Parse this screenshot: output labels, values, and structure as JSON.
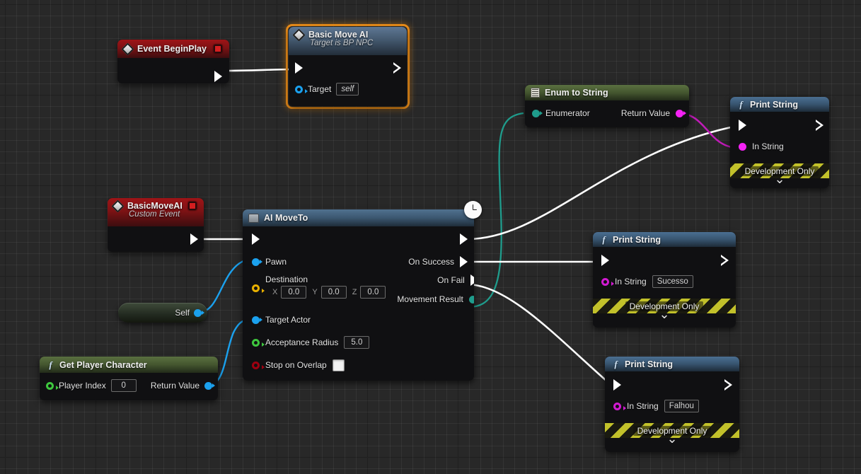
{
  "app": {
    "name": "Unreal Engine Blueprint Graph"
  },
  "canvas": {
    "grid_color": "#404040",
    "background_color": "#282828",
    "selection_color": "#f0901a"
  },
  "pin_colors": {
    "exec": "#ffffff",
    "object": "#1ba1ee",
    "vector": "#e8b000",
    "float": "#3ec73e",
    "boolean": "#9d0010",
    "string": "#f522f5",
    "enum": "#1f9c8c"
  },
  "nodes": {
    "event_begin_play": {
      "title": "Event BeginPlay",
      "icon": "event-diamond-icon",
      "delegate_icon": "red-square-icon"
    },
    "basic_move_ai": {
      "title": "Basic Move AI",
      "subtitle": "Target is BP NPC",
      "icon": "event-diamond-icon",
      "selected": true,
      "inputs": [
        {
          "label": "Target",
          "value": "self",
          "type": "object"
        }
      ]
    },
    "custom_event": {
      "title": "BasicMoveAI",
      "subtitle": "Custom Event",
      "icon": "event-diamond-icon",
      "delegate_icon": "red-square-icon"
    },
    "self_node": {
      "label": "Self",
      "type": "object"
    },
    "get_player_character": {
      "title": "Get Player Character",
      "icon": "function-f-icon",
      "inputs": [
        {
          "label": "Player Index",
          "value": "0",
          "type": "int"
        }
      ],
      "outputs": [
        {
          "label": "Return Value",
          "type": "object"
        }
      ]
    },
    "ai_move_to": {
      "title": "AI MoveTo",
      "icon": "gray-block-icon",
      "latent_icon": "clock-icon",
      "inputs": [
        {
          "label": "Pawn",
          "type": "object"
        },
        {
          "label": "Destination",
          "type": "vector",
          "vector": {
            "x_axis": "X",
            "x": "0.0",
            "y_axis": "Y",
            "y": "0.0",
            "z_axis": "Z",
            "z": "0.0"
          }
        },
        {
          "label": "Target Actor",
          "type": "object"
        },
        {
          "label": "Acceptance Radius",
          "value": "5.0",
          "type": "float"
        },
        {
          "label": "Stop on Overlap",
          "value": false,
          "type": "boolean"
        }
      ],
      "outputs": [
        {
          "label": "On Success",
          "type": "exec"
        },
        {
          "label": "On Fail",
          "type": "exec"
        },
        {
          "label": "Movement Result",
          "type": "enum"
        }
      ]
    },
    "enum_to_string": {
      "title": "Enum to String",
      "icon": "list-icon",
      "inputs": [
        {
          "label": "Enumerator",
          "type": "enum"
        }
      ],
      "outputs": [
        {
          "label": "Return Value",
          "type": "string"
        }
      ]
    },
    "print_string_result": {
      "title": "Print String",
      "icon": "function-f-icon",
      "inputs": [
        {
          "label": "In String",
          "value": "",
          "type": "string"
        }
      ],
      "banner": "Development Only",
      "expand_icon": "chevron-down-icon"
    },
    "print_string_success": {
      "title": "Print String",
      "icon": "function-f-icon",
      "inputs": [
        {
          "label": "In String",
          "value": "Sucesso",
          "type": "string"
        }
      ],
      "banner": "Development Only",
      "expand_icon": "chevron-down-icon"
    },
    "print_string_fail": {
      "title": "Print String",
      "icon": "function-f-icon",
      "inputs": [
        {
          "label": "In String",
          "value": "Falhou",
          "type": "string"
        }
      ],
      "banner": "Development Only",
      "expand_icon": "chevron-down-icon"
    }
  }
}
